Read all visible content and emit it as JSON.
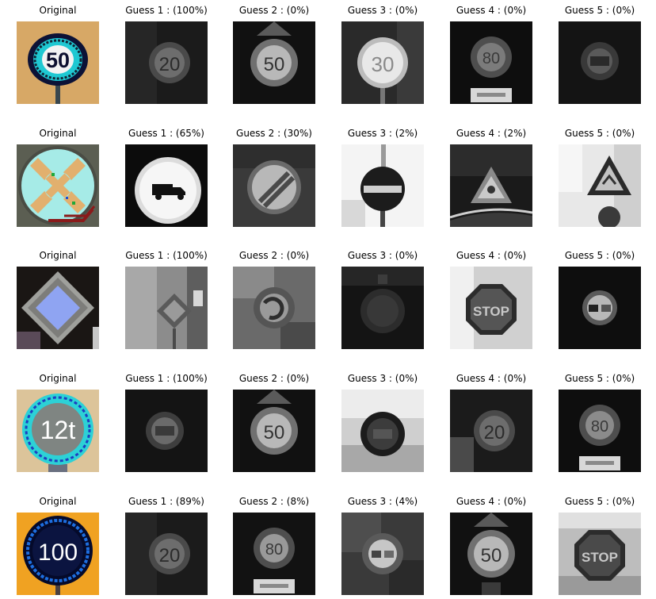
{
  "rows": [
    {
      "original_title": "Original",
      "original_sign": "speed-limit-50",
      "original_text": "50",
      "guesses": [
        {
          "title": "Guess 1 : (100%)",
          "depicts": "speed limit sign (20)"
        },
        {
          "title": "Guess 2 : (0%)",
          "depicts": "speed limit sign (50) under warning triangle"
        },
        {
          "title": "Guess 3 : (0%)",
          "depicts": "speed limit sign (30), bright"
        },
        {
          "title": "Guess 4 : (0%)",
          "depicts": "speed limit sign (80) with plate"
        },
        {
          "title": "Guess 5 : (0%)",
          "depicts": "speed limit sign, dark"
        }
      ]
    },
    {
      "original_title": "Original",
      "original_sign": "no-stopping",
      "original_text": "",
      "guesses": [
        {
          "title": "Guess 1 : (65%)",
          "depicts": "no trucks sign"
        },
        {
          "title": "Guess 2 : (30%)",
          "depicts": "end of restriction sign"
        },
        {
          "title": "Guess 3 : (2%)",
          "depicts": "no entry sign"
        },
        {
          "title": "Guess 4 : (2%)",
          "depicts": "warning triangle sign"
        },
        {
          "title": "Guess 5 : (0%)",
          "depicts": "warning triangle sign"
        }
      ]
    },
    {
      "original_title": "Original",
      "original_sign": "priority-road",
      "original_text": "",
      "guesses": [
        {
          "title": "Guess 1 : (100%)",
          "depicts": "priority road sign"
        },
        {
          "title": "Guess 2 : (0%)",
          "depicts": "roundabout sign, cluttered"
        },
        {
          "title": "Guess 3 : (0%)",
          "depicts": "round sign, dark"
        },
        {
          "title": "Guess 4 : (0%)",
          "depicts": "stop sign"
        },
        {
          "title": "Guess 5 : (0%)",
          "depicts": "no overtaking sign"
        }
      ]
    },
    {
      "original_title": "Original",
      "original_sign": "weight-limit-12t",
      "original_text": "12t",
      "guesses": [
        {
          "title": "Guess 1 : (100%)",
          "depicts": "round sign, dark"
        },
        {
          "title": "Guess 2 : (0%)",
          "depicts": "speed limit sign (50) under warning triangle"
        },
        {
          "title": "Guess 3 : (0%)",
          "depicts": "round sign with plate, bright background"
        },
        {
          "title": "Guess 4 : (0%)",
          "depicts": "speed limit sign (20)"
        },
        {
          "title": "Guess 5 : (0%)",
          "depicts": "speed limit sign (80) with plate"
        }
      ]
    },
    {
      "original_title": "Original",
      "original_sign": "speed-limit-100",
      "original_text": "100",
      "guesses": [
        {
          "title": "Guess 1 : (89%)",
          "depicts": "speed limit sign (20)"
        },
        {
          "title": "Guess 2 : (8%)",
          "depicts": "speed limit sign (80) with plate"
        },
        {
          "title": "Guess 3 : (4%)",
          "depicts": "no overtaking sign"
        },
        {
          "title": "Guess 4 : (0%)",
          "depicts": "speed limit sign (50) under warning triangle"
        },
        {
          "title": "Guess 5 : (0%)",
          "depicts": "stop sign"
        }
      ]
    }
  ],
  "palette": {
    "tan": "#d9a865",
    "teal": "#35d7dc",
    "navy": "#0b1440",
    "cyan_light": "#a8ecea",
    "orange": "#f7a51f",
    "slate": "#5a5d52",
    "blue_tile": "#8fa4f2",
    "gray_border": "#a0a0a0"
  }
}
